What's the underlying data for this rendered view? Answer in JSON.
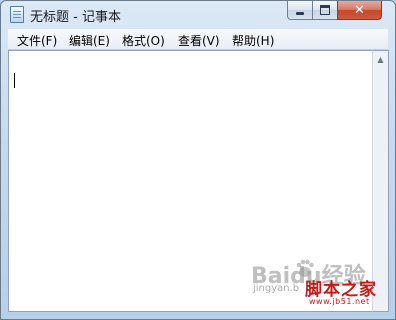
{
  "window": {
    "title": "无标题 - 记事本",
    "controls": {
      "minimize_icon": "minimize-icon",
      "maximize_icon": "maximize-icon",
      "close_icon": "close-icon",
      "close_glyph": "✕"
    }
  },
  "menu": {
    "items": [
      {
        "label": "文件(F)"
      },
      {
        "label": "编辑(E)"
      },
      {
        "label": "格式(O)"
      },
      {
        "label": "查看(V)"
      },
      {
        "label": "帮助(H)"
      }
    ]
  },
  "editor": {
    "content": ""
  },
  "scrollbar": {
    "up_arrow": "▲"
  },
  "watermarks": {
    "baidu_logo_text": "Baidu经验",
    "jingyan_url": "jingyan.b",
    "site_name": "脚本之家",
    "site_url": "www.jb51.net"
  },
  "colors": {
    "title_gradient_top": "#dbe8f6",
    "close_button": "#c5472f",
    "watermark_red": "#c41a1a"
  }
}
